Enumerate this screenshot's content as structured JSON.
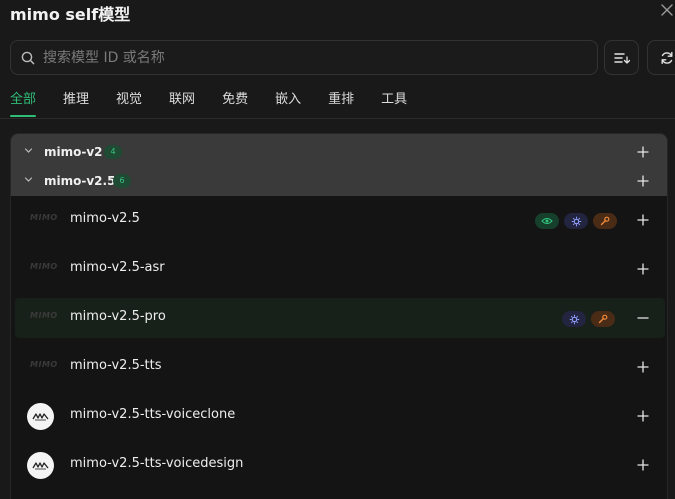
{
  "header": {
    "title": "mimo self模型"
  },
  "search": {
    "placeholder": "搜索模型 ID 或名称",
    "value": ""
  },
  "tabs": [
    {
      "label": "全部",
      "active": true
    },
    {
      "label": "推理",
      "active": false
    },
    {
      "label": "视觉",
      "active": false
    },
    {
      "label": "联网",
      "active": false
    },
    {
      "label": "免费",
      "active": false
    },
    {
      "label": "嵌入",
      "active": false
    },
    {
      "label": "重排",
      "active": false
    },
    {
      "label": "工具",
      "active": false
    }
  ],
  "groups": [
    {
      "name": "mimo-v2",
      "count": "4",
      "expanded": false
    },
    {
      "name": "mimo-v2.5",
      "count": "6",
      "expanded": true
    }
  ],
  "models": [
    {
      "name": "mimo-v2.5",
      "logo": "mimo-wordmark",
      "logo_text": "MIMO",
      "badges": [
        "eye-icon",
        "gear-icon",
        "wrench-icon"
      ],
      "action": "add"
    },
    {
      "name": "mimo-v2.5-asr",
      "logo": "mimo-wordmark",
      "logo_text": "MIMO",
      "badges": [],
      "action": "add"
    },
    {
      "name": "mimo-v2.5-pro",
      "logo": "mimo-wordmark",
      "logo_text": "MIMO",
      "badges": [
        "gear-icon",
        "wrench-icon"
      ],
      "action": "remove"
    },
    {
      "name": "mimo-v2.5-tts",
      "logo": "mimo-wordmark",
      "logo_text": "MIMO",
      "badges": [],
      "action": "add"
    },
    {
      "name": "mimo-v2.5-tts-voiceclone",
      "logo": "mimo-circle-logo",
      "logo_text": "",
      "badges": [],
      "action": "add"
    },
    {
      "name": "mimo-v2.5-tts-voicedesign",
      "logo": "mimo-circle-logo",
      "logo_text": "",
      "badges": [],
      "action": "add"
    }
  ],
  "colors": {
    "accent": "#2fbd78",
    "background": "#191919",
    "group_header": "#3a3a3a",
    "vision_badge": "#16402c",
    "reasoning_badge": "#23243f",
    "tools_badge": "#4a2c16"
  }
}
